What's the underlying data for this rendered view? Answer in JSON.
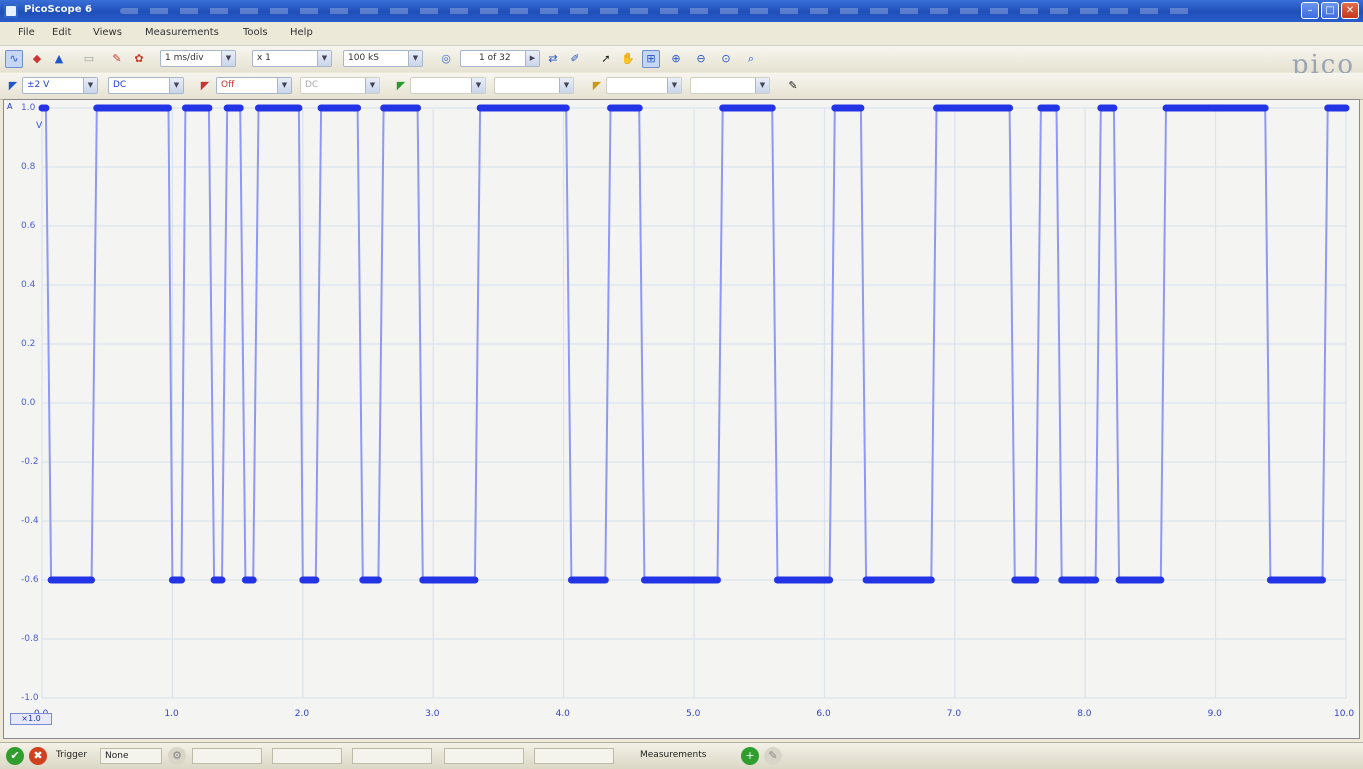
{
  "window": {
    "title": "PicoScope 6"
  },
  "menu": [
    "File",
    "Edit",
    "Views",
    "Measurements",
    "Tools",
    "Help"
  ],
  "toolbar": {
    "timebase": "1 ms/div",
    "zoom": "x 1",
    "samples": "100 kS",
    "buffer": "1 of 32"
  },
  "channels": {
    "a_range": "±2 V",
    "a_coupling": "DC",
    "b_coupling": "DC",
    "b_range": "Off"
  },
  "brand": "pico",
  "plot": {
    "unit": "V",
    "yticks": [
      "1.0",
      "0.8",
      "0.6",
      "0.4",
      "0.2",
      "0.0",
      "-0.2",
      "-0.4",
      "-0.6",
      "-0.8",
      "-1.0"
    ],
    "xticks": [
      "0.0",
      "1.0",
      "2.0",
      "3.0",
      "4.0",
      "5.0",
      "6.0",
      "7.0",
      "8.0",
      "9.0",
      "10.0"
    ],
    "channel_label": "A",
    "zero_tag": "×1.0"
  },
  "status": {
    "trigger_label": "Trigger",
    "trigger_mode": "None",
    "measurements_label": "Measurements"
  },
  "chart_data": {
    "type": "line",
    "title": "",
    "xlabel": "",
    "ylabel": "V",
    "xlim": [
      0,
      10
    ],
    "ylim": [
      -1.0,
      1.0
    ],
    "grid": true,
    "series": [
      {
        "color": "#2333e6",
        "x": [
          0.0,
          0.03,
          0.07,
          0.38,
          0.42,
          0.97,
          1.0,
          1.07,
          1.1,
          1.28,
          1.32,
          1.38,
          1.42,
          1.52,
          1.56,
          1.62,
          1.66,
          1.97,
          2.0,
          2.1,
          2.14,
          2.42,
          2.46,
          2.58,
          2.62,
          2.88,
          2.92,
          3.32,
          3.36,
          4.02,
          4.06,
          4.32,
          4.36,
          4.58,
          4.62,
          5.18,
          5.22,
          5.6,
          5.64,
          6.04,
          6.08,
          6.28,
          6.32,
          6.82,
          6.86,
          7.42,
          7.46,
          7.62,
          7.66,
          7.78,
          7.82,
          8.08,
          8.12,
          8.22,
          8.26,
          8.58,
          8.62,
          9.38,
          9.42,
          9.82,
          9.86,
          9.96,
          10.0
        ],
        "y": [
          1.0,
          1.0,
          -0.6,
          -0.6,
          1.0,
          1.0,
          -0.6,
          -0.6,
          1.0,
          1.0,
          -0.6,
          -0.6,
          1.0,
          1.0,
          -0.6,
          -0.6,
          1.0,
          1.0,
          -0.6,
          -0.6,
          1.0,
          1.0,
          -0.6,
          -0.6,
          1.0,
          1.0,
          -0.6,
          -0.6,
          1.0,
          1.0,
          -0.6,
          -0.6,
          1.0,
          1.0,
          -0.6,
          -0.6,
          1.0,
          1.0,
          -0.6,
          -0.6,
          1.0,
          1.0,
          -0.6,
          -0.6,
          1.0,
          1.0,
          -0.6,
          -0.6,
          1.0,
          1.0,
          -0.6,
          -0.6,
          1.0,
          1.0,
          -0.6,
          -0.6,
          1.0,
          1.0,
          -0.6,
          -0.6,
          1.0,
          1.0,
          1.0
        ]
      }
    ]
  }
}
